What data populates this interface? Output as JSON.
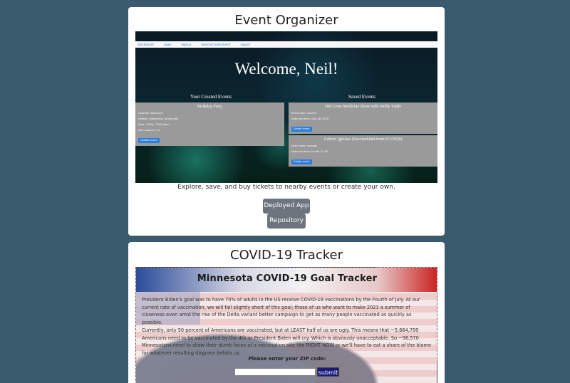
{
  "projects": [
    {
      "title": "Event Organizer",
      "screenshot": {
        "nav": [
          "Dashboard",
          "Login",
          "Signup",
          "Search/Create Event",
          "Logout"
        ],
        "welcome": "Welcome, Neil!",
        "created_heading": "Your Created Events",
        "saved_heading": "Saved Events",
        "created_events": [
          {
            "title": "Birthday Party",
            "lines": [
              "Location: Backyard",
              "Details: Celebration, bring gifts",
              "Date: 5 May, 7:00:00pm",
              "Max capacity: 25"
            ],
            "button": "Update event"
          }
        ],
        "saved_events": [
          {
            "title": "Old Crow Medicine Show with Molly Tuttle",
            "lines": [
              "Event type: concert",
              "Date and time: Aug 1st 2019"
            ],
            "button": "Delete event"
          },
          {
            "title": "Gabriel Iglesias (Rescheduled from 8/1/2020)",
            "lines": [
              "Event type: comedy",
              "Date and time: Jul 8th 21:30"
            ],
            "button": "Delete event"
          }
        ]
      },
      "description": "Explore, save, and buy tickets to nearby events or create your own.",
      "buttons": {
        "deployed": "Deployed App",
        "repository": "Repository"
      }
    },
    {
      "title": "COVID-19 Tracker",
      "screenshot": {
        "heading": "Minnesota COVID-19 Goal Tracker",
        "paragraph1": "President Biden's goal was to have 70% of adults in the US receive COVID-19 vaccinations by the Fourth of July. At our current rate of vaccination, we will fall slightly short of this goal; those of us who want to make 2021 a summer of closeness even amid the rise of the Delta variant better campaign to get as many people vaccinated as quickly as possible.",
        "paragraph2": "Currently, only 50 percent of Americans are vaccinated, but at LEAST half of us are ugly. This means that ~5,664,799 Americans need to be vaccinated by the 4th or President Biden will cry. Which is obviously unacceptable. So ~96,570 Minnesotans need to show their dumb faces at a vaccination site like RIGHT NOW or we'll have to eat a share of the blame for whatever resulting disgrace befalls us.",
        "zip_label": "Please enter your ZIP code:",
        "zip_value": "",
        "submit": "submit"
      }
    }
  ]
}
